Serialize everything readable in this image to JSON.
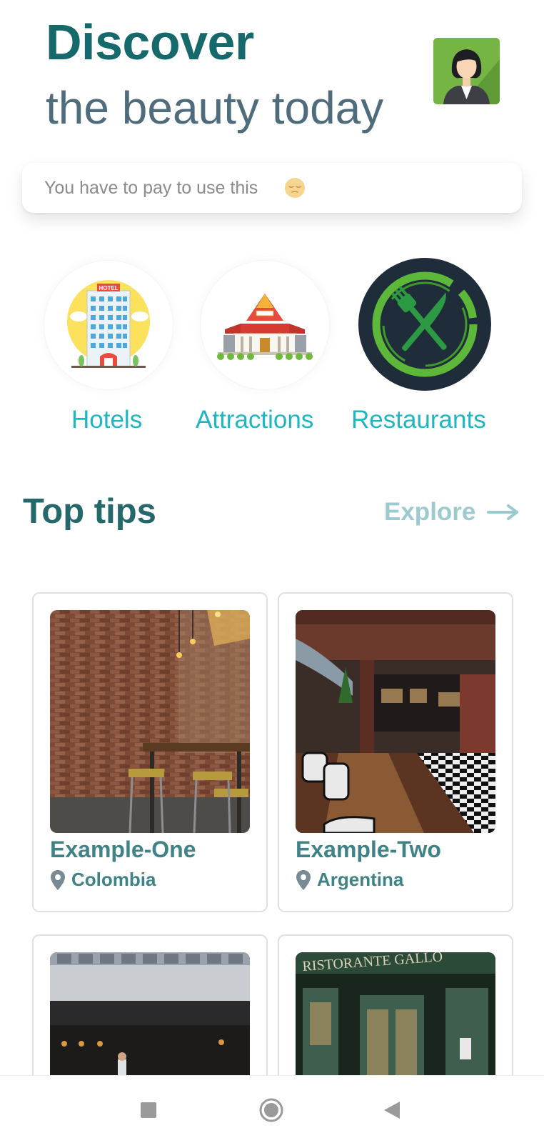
{
  "header": {
    "title": "Discover",
    "subtitle": "the beauty today"
  },
  "search": {
    "placeholder": "You have to pay to use this",
    "emoji": "pensive-face-emoji"
  },
  "categories": [
    {
      "label": "Hotels",
      "icon": "hotel-icon"
    },
    {
      "label": "Attractions",
      "icon": "temple-icon"
    },
    {
      "label": "Restaurants",
      "icon": "fork-knife-icon"
    }
  ],
  "top_tips": {
    "title": "Top tips",
    "explore_label": "Explore"
  },
  "cards": [
    {
      "name": "Example-One",
      "location": "Colombia"
    },
    {
      "name": "Example-Two",
      "location": "Argentina"
    },
    {
      "name": "",
      "location": ""
    },
    {
      "name": "",
      "location": ""
    }
  ],
  "colors": {
    "title": "#16696b",
    "subtitle": "#4f6c7c",
    "category_label": "#1fb6c2",
    "card_text": "#3f8386",
    "explore": "#9ccbcf"
  },
  "navigation": {
    "buttons": [
      "recents-button",
      "home-button",
      "back-button"
    ]
  }
}
